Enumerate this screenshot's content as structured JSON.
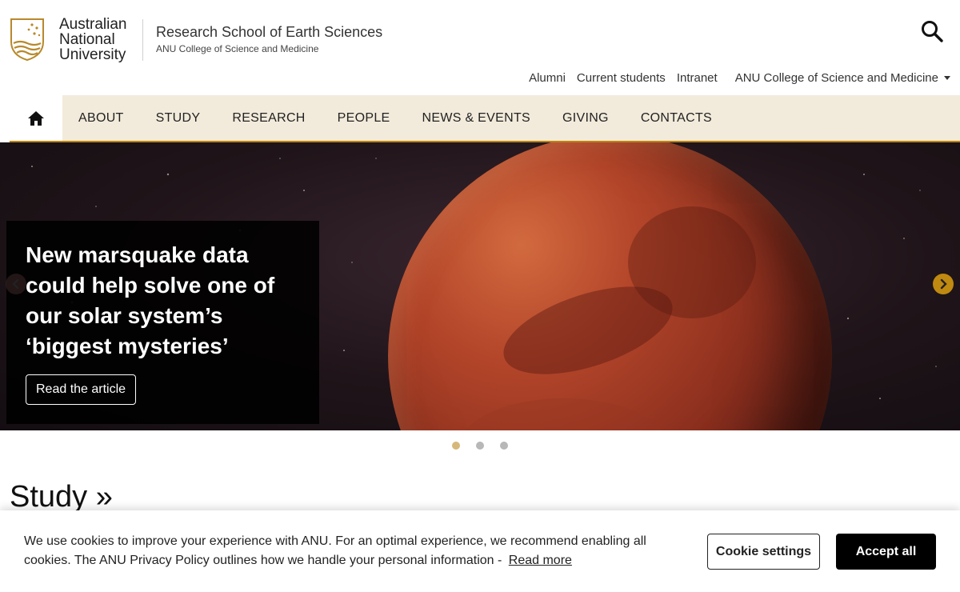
{
  "header": {
    "university_name": [
      "Australian",
      "National",
      "University"
    ],
    "school_title": "Research School of Earth Sciences",
    "school_subtitle": "ANU College of Science and Medicine"
  },
  "utility_nav": {
    "links": [
      "Alumni",
      "Current students",
      "Intranet"
    ],
    "college_dropdown": "ANU College of Science and Medicine"
  },
  "main_nav": {
    "items": [
      "ABOUT",
      "STUDY",
      "RESEARCH",
      "PEOPLE",
      "NEWS & EVENTS",
      "GIVING",
      "CONTACTS"
    ]
  },
  "hero": {
    "headline": "New marsquake data could help solve one of our solar system’s ‘biggest mysteries’",
    "button_label": "Read the article",
    "slide_count": 3,
    "active_slide": 1
  },
  "section": {
    "study_heading": "Study »"
  },
  "cookie_banner": {
    "message": "We use cookies to improve your experience with ANU. For an optimal experience, we recommend enabling all cookies. The ANU Privacy Policy outlines how we handle your personal information -",
    "read_more": "Read more",
    "settings_label": "Cookie settings",
    "accept_label": "Accept all"
  },
  "colors": {
    "accent_gold": "#be830e",
    "nav_background": "#f2ebdb",
    "active_dot": "#d6b87a"
  },
  "icons": {
    "logo": "anu-crest-icon",
    "search": "search-icon",
    "home": "home-icon",
    "prev": "chevron-left-icon",
    "next": "chevron-right-icon"
  }
}
